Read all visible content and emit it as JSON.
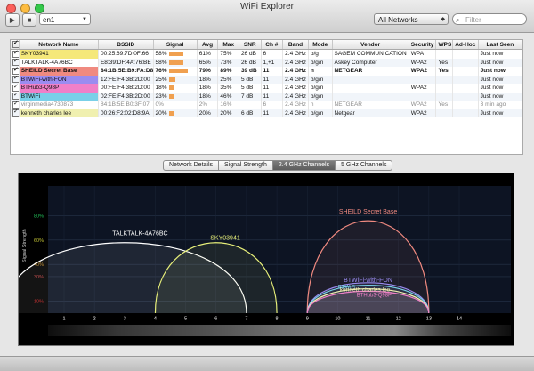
{
  "window": {
    "title": "WiFi Explorer"
  },
  "toolbar": {
    "play_glyph": "▶",
    "stop_glyph": "■",
    "interface": "en1",
    "network_filter": "All Networks",
    "search_placeholder": "Filter"
  },
  "table": {
    "headers": [
      "✓",
      "Network Name",
      "BSSID",
      "Signal",
      "Avg",
      "Max",
      "SNR",
      "Ch #",
      "Band",
      "Mode",
      "Vendor",
      "Security",
      "WPS",
      "Ad-Hoc",
      "Last Seen"
    ],
    "rows": [
      {
        "color": "#f5e87a",
        "name": "SKY03941",
        "bssid": "00:25:69:7D:0F:66",
        "signal": "58%",
        "signal_level": 0.58,
        "avg": "61%",
        "max": "75%",
        "snr": "26 dB",
        "ch": "6",
        "band": "2.4 GHz",
        "mode": "b/g",
        "vendor": "SAGEM COMMUNICATION",
        "security": "WPA",
        "wps": "",
        "adhoc": "",
        "last": "Just now",
        "style": ""
      },
      {
        "color": "#ffffff",
        "name": "TALKTALK-4A76BC",
        "bssid": "E8:39:DF:4A:76:BE",
        "signal": "58%",
        "signal_level": 0.58,
        "avg": "65%",
        "max": "73%",
        "snr": "26 dB",
        "ch": "1,+1",
        "band": "2.4 GHz",
        "mode": "b/g/n",
        "vendor": "Askey Computer",
        "security": "WPA2",
        "wps": "Yes",
        "adhoc": "",
        "last": "Just now",
        "style": ""
      },
      {
        "color": "#f08a80",
        "name": "SHEILD Secret Base",
        "bssid": "84:1B:5E:B9:FA:D8",
        "signal": "76%",
        "signal_level": 0.76,
        "avg": "79%",
        "max": "89%",
        "snr": "39 dB",
        "ch": "11",
        "band": "2.4 GHz",
        "mode": "n",
        "vendor": "NETGEAR",
        "security": "WPA2",
        "wps": "Yes",
        "adhoc": "",
        "last": "Just now",
        "style": "bold"
      },
      {
        "color": "#9a8cf0",
        "name": "BTWiFi-with-FON",
        "bssid": "12:FE:F4:3B:2D:00",
        "signal": "25%",
        "signal_level": 0.25,
        "avg": "18%",
        "max": "25%",
        "snr": "5 dB",
        "ch": "11",
        "band": "2.4 GHz",
        "mode": "b/g/n",
        "vendor": "",
        "security": "",
        "wps": "",
        "adhoc": "",
        "last": "Just now",
        "style": ""
      },
      {
        "color": "#f080c8",
        "name": "BTHub3-Q98P",
        "bssid": "00:FE:F4:3B:2D:00",
        "signal": "18%",
        "signal_level": 0.18,
        "avg": "18%",
        "max": "35%",
        "snr": "5 dB",
        "ch": "11",
        "band": "2.4 GHz",
        "mode": "b/g/n",
        "vendor": "",
        "security": "WPA2",
        "wps": "",
        "adhoc": "",
        "last": "Just now",
        "style": ""
      },
      {
        "color": "#7ad0e8",
        "name": "BTWiFi",
        "bssid": "02:FE:F4:3B:2D:00",
        "signal": "23%",
        "signal_level": 0.23,
        "avg": "18%",
        "max": "46%",
        "snr": "7 dB",
        "ch": "11",
        "band": "2.4 GHz",
        "mode": "b/g/n",
        "vendor": "",
        "security": "",
        "wps": "",
        "adhoc": "",
        "last": "Just now",
        "style": ""
      },
      {
        "color": "#ffffff",
        "name": "virginmedia4730873",
        "bssid": "84:1B:5E:B0:3F:07",
        "signal": "0%",
        "signal_level": 0,
        "avg": "2%",
        "max": "16%",
        "snr": "",
        "ch": "6",
        "band": "2.4 GHz",
        "mode": "n",
        "vendor": "NETGEAR",
        "security": "WPA2",
        "wps": "Yes",
        "adhoc": "",
        "last": "3 min ago",
        "style": "dim"
      },
      {
        "color": "#f0f0b0",
        "name": "kenneth charles lee",
        "bssid": "00:26:F2:02:D8:9A",
        "signal": "20%",
        "signal_level": 0.2,
        "avg": "20%",
        "max": "20%",
        "snr": "6 dB",
        "ch": "11",
        "band": "2.4 GHz",
        "mode": "b/g/n",
        "vendor": "Netgear",
        "security": "WPA2",
        "wps": "",
        "adhoc": "",
        "last": "Just now",
        "style": ""
      }
    ]
  },
  "tabs": [
    "Network Details",
    "Signal Strength",
    "2.4 GHz Channels",
    "5 GHz Channels"
  ],
  "active_tab": 2,
  "chart_data": {
    "type": "area",
    "ylabel": "Signal Strength",
    "yticks": [
      "80%",
      "60%",
      "40%",
      "30%",
      "10%"
    ],
    "x_channels": [
      1,
      2,
      3,
      4,
      5,
      6,
      7,
      8,
      9,
      10,
      11,
      12,
      13,
      14
    ],
    "ylim": [
      0,
      100
    ],
    "series": [
      {
        "name": "TALKTALK-4A76BC",
        "center": 3,
        "half_width": 4,
        "value": 58,
        "color": "#ffffff"
      },
      {
        "name": "SKY03941",
        "center": 6,
        "half_width": 2,
        "value": 58,
        "color": "#e8f07a"
      },
      {
        "name": "SHEILD Secret Base",
        "center": 11,
        "half_width": 2,
        "value": 76,
        "color": "#f08a80"
      },
      {
        "name": "BTWiFi-with-FON",
        "center": 11,
        "half_width": 2,
        "value": 25,
        "color": "#9a8cf0"
      },
      {
        "name": "BTWiFi",
        "center": 11,
        "half_width": 2,
        "value": 23,
        "color": "#7ad0e8"
      },
      {
        "name": "kenneth charles lee",
        "center": 11,
        "half_width": 2,
        "value": 20,
        "color": "#f0f0b0"
      },
      {
        "name": "BTHub3-Q98P",
        "center": 11,
        "half_width": 2,
        "value": 18,
        "color": "#f080c8"
      }
    ]
  }
}
